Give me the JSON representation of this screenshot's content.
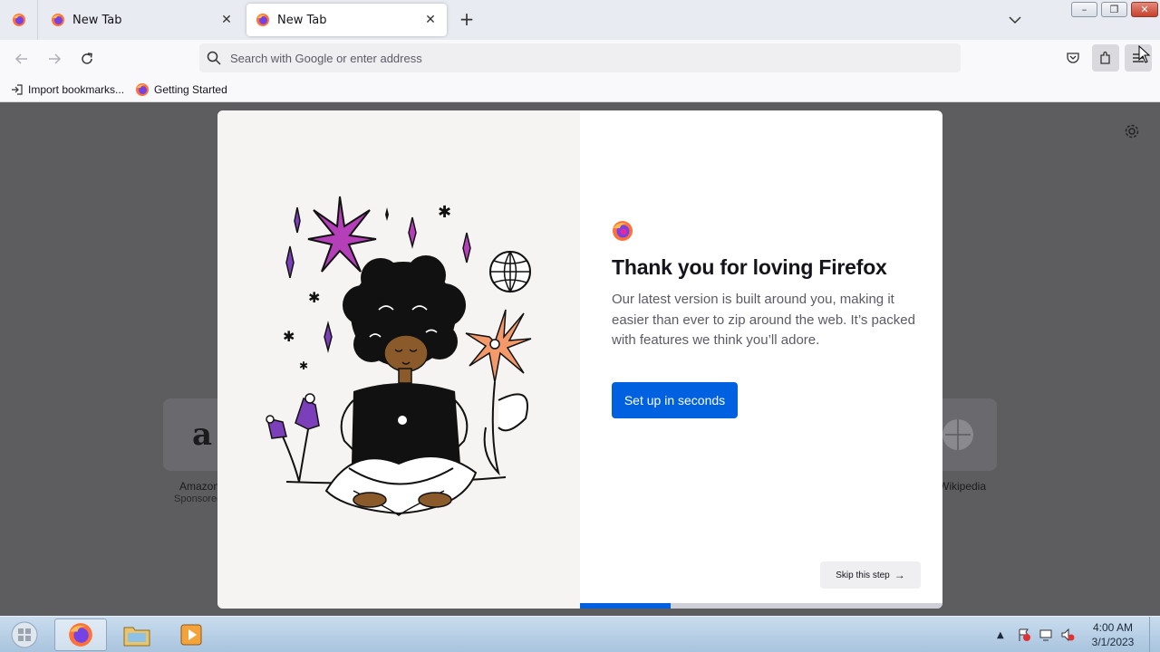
{
  "tabs": {
    "pinned_icon": "firefox-icon",
    "items": [
      {
        "label": "New Tab",
        "icon": "firefox-icon"
      },
      {
        "label": "New Tab",
        "icon": "firefox-icon",
        "active": true
      }
    ],
    "new_tab": "+"
  },
  "window": {
    "minimize": "–",
    "maximize": "❐",
    "close": "✕"
  },
  "nav": {
    "url_placeholder": "Search with Google or enter address"
  },
  "bookmarks": [
    {
      "label": "Import bookmarks...",
      "icon": "import-icon"
    },
    {
      "label": "Getting Started",
      "icon": "firefox-icon"
    }
  ],
  "shortcuts": [
    {
      "label": "Amazon",
      "sub": "Sponsored"
    },
    {
      "label": "Wikipedia"
    }
  ],
  "modal": {
    "title": "Thank you for loving Firefox",
    "body": "Our latest version is built around you, making it easier than ever to zip around the web. It’s packed with features we think you’ll adore.",
    "primary_button": "Set up in seconds",
    "skip_button": "Skip this step",
    "progress": 0.25
  },
  "taskbar": {
    "time": "4:00 AM",
    "date": "3/1/2023"
  },
  "colors": {
    "accent": "#0061e0",
    "overlay": "#5d5d60"
  }
}
